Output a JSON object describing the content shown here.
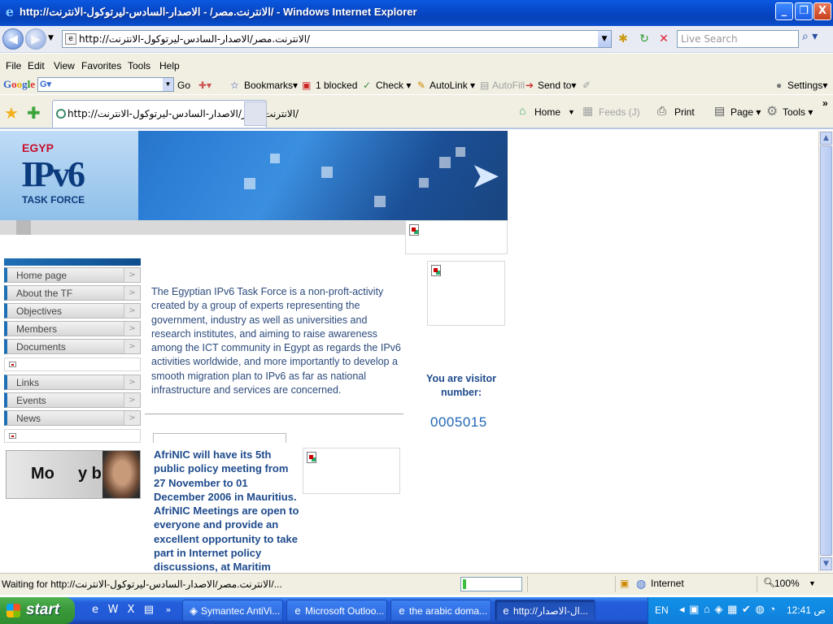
{
  "window": {
    "title": "http://الانترنت.مصر/ - الاصدار-السادس-ليرتوكول-الانترنت/ - Windows Internet Explorer",
    "minimize": "_",
    "maximize": "❐",
    "close": "X"
  },
  "address_bar": {
    "url": "http://الانترنت.مصر/الاصدار-السادس-ليرتوكول-الانترنت/",
    "search_placeholder": "Live Search"
  },
  "menu": [
    "File",
    "Edit",
    "View",
    "Favorites",
    "Tools",
    "Help"
  ],
  "google_toolbar": {
    "logo": "Google",
    "input_prefix": "G▾",
    "go": "Go",
    "bookmarks": "Bookmarks▾",
    "blocked": "1 blocked",
    "check": "Check ▾",
    "autolink": "AutoLink ▾",
    "autofill": "AutoFill",
    "send_to": "Send to▾",
    "settings": "Settings▾"
  },
  "tab": {
    "label": "http://الانترنت.مصر/الاصدار-السادس-ليرتوكول-الانترنت/"
  },
  "command_bar": {
    "home": "Home",
    "feeds": "Feeds (J)",
    "print": "Print",
    "page": "Page ▾",
    "tools": "Tools ▾"
  },
  "page": {
    "banner": {
      "egypt": "EGYP",
      "ipv6": "IPv6",
      "task": "TASK FORCE"
    },
    "nav_items": [
      "Home page",
      "About the TF",
      "Objectives",
      "Members",
      "Documents",
      "Links",
      "Events",
      "News"
    ],
    "promo": {
      "left": "Mo",
      "right": "y b"
    },
    "intro": "The Egyptian IPv6 Task Force is a non-proft-activity created by a group of experts representing the government, industry as well as universities and research institutes, and aiming to raise awareness among the ICT community in Egypt as regards the IPv6 activities worldwide, and more importantly to develop a smooth migration plan to IPv6 as far as national infrastructure and services are concerned.",
    "news": "AfriNIC will have its 5th public policy meeting from 27 November to 01 December 2006 in Mauritius. AfriNIC Meetings are open to everyone and provide an excellent opportunity to take part in Internet policy discussions, at Maritim Hotel.",
    "visitor_label": "You are visitor number:",
    "visitor_count": "0005015"
  },
  "status_bar": {
    "text": "Waiting for http://الانترنت.مصر/الاصدار-السادس-ليرتوكول-الانترنت/...",
    "progress": 0.05,
    "zone": "Internet",
    "zoom": "100%"
  },
  "taskbar": {
    "start": "start",
    "tasks": [
      {
        "label": "Symantec AntiVi...",
        "icon": "shield-icon",
        "active": false
      },
      {
        "label": "Microsoft Outloo...",
        "icon": "ie-icon",
        "active": false
      },
      {
        "label": "the arabic doma...",
        "icon": "ie-icon",
        "active": false
      },
      {
        "label": "http://ال-الاصدار...",
        "icon": "ie-icon",
        "active": true
      }
    ],
    "language": "EN",
    "clock": "12:41 ص"
  }
}
